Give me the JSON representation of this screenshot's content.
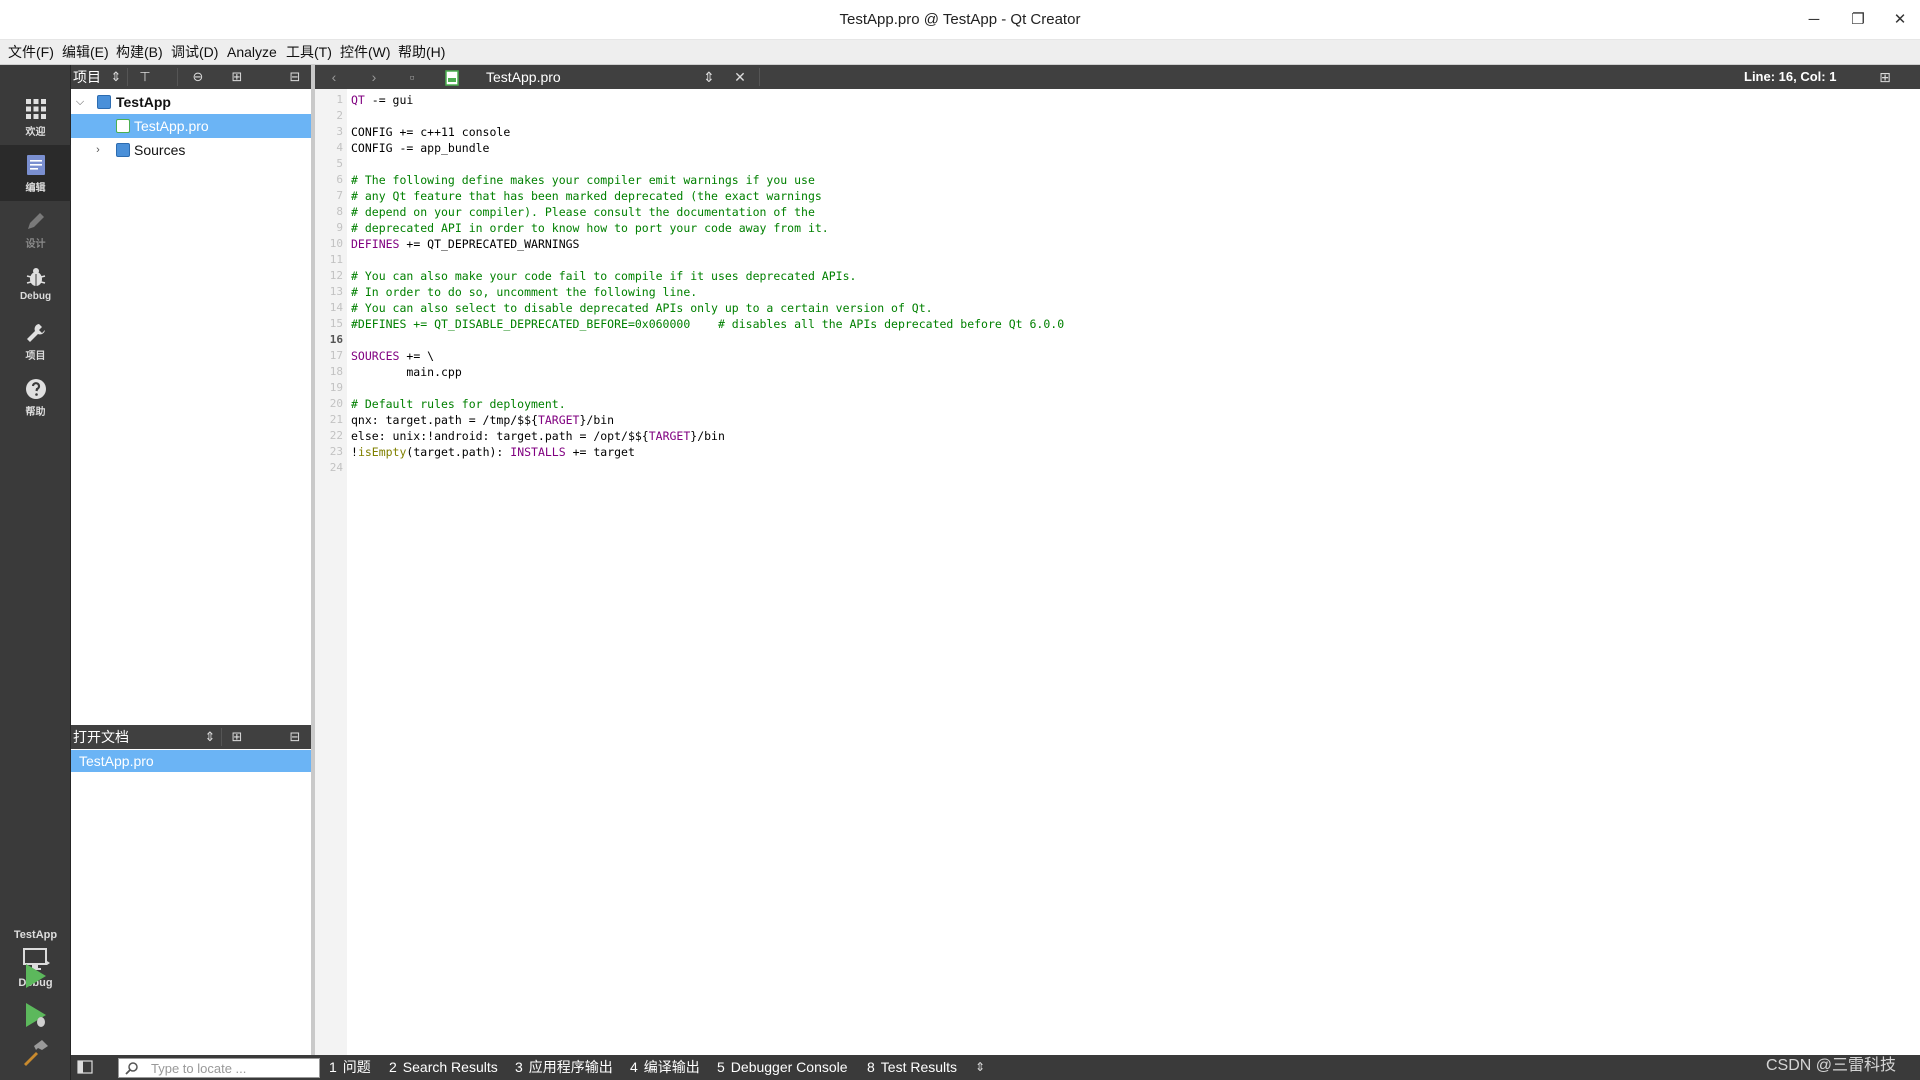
{
  "window": {
    "title": "TestApp.pro @ TestApp - Qt Creator",
    "min_glyph": "─",
    "max_glyph": "❐",
    "close_glyph": "✕"
  },
  "menu": [
    "文件(F)",
    "编辑(E)",
    "构建(B)",
    "调试(D)",
    "Analyze",
    "工具(T)",
    "控件(W)",
    "帮助(H)"
  ],
  "modes": [
    {
      "label": "欢迎",
      "icon": "grid-icon",
      "active": false
    },
    {
      "label": "编辑",
      "icon": "edit-document-icon",
      "active": true
    },
    {
      "label": "设计",
      "icon": "pencil-icon",
      "active": false
    },
    {
      "label": "Debug",
      "icon": "bug-icon",
      "active": false
    },
    {
      "label": "项目",
      "icon": "wrench-icon",
      "active": false
    },
    {
      "label": "帮助",
      "icon": "help-icon",
      "active": false
    }
  ],
  "kit": {
    "project": "TestApp",
    "build": "Debug"
  },
  "projects_panel": {
    "title": "项目",
    "tree": [
      {
        "label": "TestApp",
        "level": 0,
        "expanded": true,
        "bold": true,
        "selected": false
      },
      {
        "label": "TestApp.pro",
        "level": 1,
        "selected": true
      },
      {
        "label": "Sources",
        "level": 1,
        "expanded": false,
        "selected": false
      }
    ]
  },
  "open_docs_panel": {
    "title": "打开文档",
    "docs": [
      "TestApp.pro"
    ]
  },
  "editor": {
    "file": "TestApp.pro",
    "position": "Line: 16, Col: 1",
    "current_line": 16,
    "lines": [
      [
        [
          "kw",
          "QT"
        ],
        [
          "t",
          " -= gui"
        ]
      ],
      [],
      [
        [
          "t",
          "CONFIG += c++11 console"
        ]
      ],
      [
        [
          "t",
          "CONFIG -= app_bundle"
        ]
      ],
      [],
      [
        [
          "cm",
          "# The following define makes your compiler emit warnings if you use"
        ]
      ],
      [
        [
          "cm",
          "# any Qt feature that has been marked deprecated (the exact warnings"
        ]
      ],
      [
        [
          "cm",
          "# depend on your compiler). Please consult the documentation of the"
        ]
      ],
      [
        [
          "cm",
          "# deprecated API in order to know how to port your code away from it."
        ]
      ],
      [
        [
          "kw",
          "DEFINES"
        ],
        [
          "t",
          " += QT_DEPRECATED_WARNINGS"
        ]
      ],
      [],
      [
        [
          "cm",
          "# You can also make your code fail to compile if it uses deprecated APIs."
        ]
      ],
      [
        [
          "cm",
          "# In order to do so, uncomment the following line."
        ]
      ],
      [
        [
          "cm",
          "# You can also select to disable deprecated APIs only up to a certain version of Qt."
        ]
      ],
      [
        [
          "cm",
          "#DEFINES += QT_DISABLE_DEPRECATED_BEFORE=0x060000    # disables all the APIs deprecated before Qt 6.0.0"
        ]
      ],
      [],
      [
        [
          "kw",
          "SOURCES"
        ],
        [
          "t",
          " += \\"
        ]
      ],
      [
        [
          "t",
          "        main.cpp"
        ]
      ],
      [],
      [
        [
          "cm",
          "# Default rules for deployment."
        ]
      ],
      [
        [
          "t",
          "qnx: target.path = /tmp/$${"
        ],
        [
          "var",
          "TARGET"
        ],
        [
          "t",
          "}/bin"
        ]
      ],
      [
        [
          "t",
          "else: unix:!android: target.path = /opt/$${"
        ],
        [
          "var",
          "TARGET"
        ],
        [
          "t",
          "}/bin"
        ]
      ],
      [
        [
          "t",
          "!"
        ],
        [
          "fn",
          "isEmpty"
        ],
        [
          "t",
          "(target.path): "
        ],
        [
          "kw",
          "INSTALLS"
        ],
        [
          "t",
          " += target"
        ]
      ],
      []
    ]
  },
  "statusbar": {
    "locator_placeholder": "Type to locate ...",
    "panes": [
      {
        "num": "1",
        "label": "问题"
      },
      {
        "num": "2",
        "label": "Search Results"
      },
      {
        "num": "3",
        "label": "应用程序输出"
      },
      {
        "num": "4",
        "label": "编译输出"
      },
      {
        "num": "5",
        "label": "Debugger Console"
      },
      {
        "num": "8",
        "label": "Test Results"
      }
    ]
  },
  "watermark": "CSDN @三雷科技",
  "colors": {
    "selection": "#6bb4f5",
    "sidebar": "#3a3a3a",
    "toolbar": "#404040",
    "comment": "#008000",
    "keyword": "#800080",
    "run": "#5cb85c"
  }
}
